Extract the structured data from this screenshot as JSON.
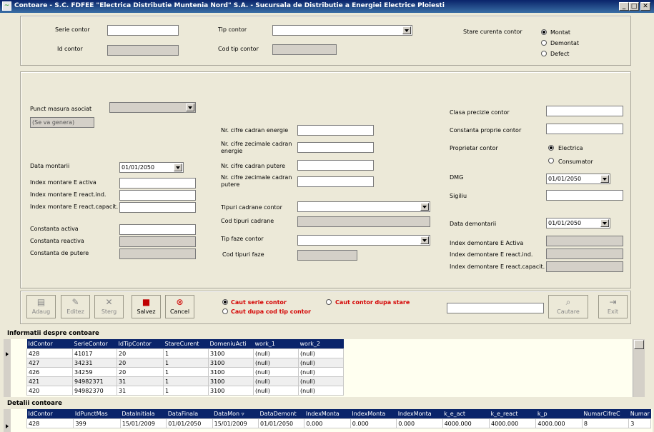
{
  "window": {
    "title": "Contoare - S.C. FDFEE \"Electrica Distributie Muntenia Nord\" S.A. - Sucursala de Distributie a Energiei Electrice Ploiesti",
    "minimize_glyph": "_",
    "maximize_glyph": "□",
    "close_glyph": "✕"
  },
  "top": {
    "serie_label": "Serie contor",
    "serie_value": "",
    "id_label": "Id contor",
    "tip_label": "Tip contor",
    "tip_value": "",
    "cod_tip_label": "Cod tip contor",
    "stare_label": "Stare curenta contor",
    "stare_options": [
      "Montat",
      "Demontat",
      "Defect"
    ],
    "stare_selected": "Montat"
  },
  "detail": {
    "punct_label": "Punct masura asociat",
    "punct_placeholder": "(Se va genera)",
    "data_montarii_label": "Data montarii",
    "data_montarii_value": "01/01/2050",
    "idx_activa_label": "Index montare E activa",
    "idx_react_ind_label": "Index montare E react.ind.",
    "idx_react_cap_label": "Index montare E react.capacit.",
    "const_activa_label": "Constanta activa",
    "const_reactiva_label": "Constanta reactiva",
    "const_putere_label": "Constanta de putere",
    "nr_cifre_energie_label": "Nr. cifre cadran energie",
    "nr_zec_energie_label": "Nr. cifre zecimale cadran energie",
    "nr_cifre_putere_label": "Nr. cifre cadran putere",
    "nr_zec_putere_label": "Nr. cifre zecimale cadran putere",
    "tipuri_cadrane_label": "Tipuri cadrane contor",
    "cod_tipuri_cadrane_label": "Cod tipuri cadrane",
    "tip_faze_label": "Tip faze contor",
    "cod_tipuri_faze_label": "Cod tipuri faze",
    "clasa_label": "Clasa precizie contor",
    "constanta_proprie_label": "Constanta proprie contor",
    "proprietar_label": "Proprietar contor",
    "proprietar_options": [
      "Electrica",
      "Consumator"
    ],
    "proprietar_selected": "Electrica",
    "dmg_label": "DMG",
    "dmg_value": "01/01/2050",
    "sigiliu_label": "Sigiliu",
    "data_demontarii_label": "Data demontarii",
    "data_demontarii_value": "01/01/2050",
    "idx_dem_activa_label": "Index demontare E Activa",
    "idx_dem_react_ind_label": "Index demontare E react.ind.",
    "idx_dem_react_cap_label": "Index demontare E react.capacit."
  },
  "toolbar": {
    "adaug": "Adaug",
    "editez": "Editez",
    "sterg": "Sterg",
    "salvez": "Salvez",
    "cancel": "Cancel",
    "search_opt_serie": "Caut serie contor",
    "search_opt_cod": "Caut dupa cod tip contor",
    "search_opt_stare": "Caut contor dupa stare",
    "search_value": "",
    "cautare": "Cautare",
    "exit": "Exit"
  },
  "grid1": {
    "title": "Informatii despre contoare",
    "columns": [
      "IdContor",
      "SerieContor",
      "IdTipContor",
      "StareCurent",
      "DomeniuActi",
      "work_1",
      "work_2"
    ],
    "rows": [
      [
        "428",
        "41017",
        "20",
        "1",
        "3100",
        "(null)",
        "(null)"
      ],
      [
        "427",
        "34231",
        "20",
        "1",
        "3100",
        "(null)",
        "(null)"
      ],
      [
        "426",
        "34259",
        "20",
        "1",
        "3100",
        "(null)",
        "(null)"
      ],
      [
        "421",
        "94982371",
        "31",
        "1",
        "3100",
        "(null)",
        "(null)"
      ],
      [
        "420",
        "94982370",
        "31",
        "1",
        "3100",
        "(null)",
        "(null)"
      ]
    ]
  },
  "grid2": {
    "title": "Detalii contoare",
    "columns": [
      "IdContor",
      "IdPunctMas",
      "DataInitiala",
      "DataFinala",
      "DataMon ▿",
      "DataDemont",
      "IndexMonta",
      "IndexMonta",
      "IndexMonta",
      "k_e_act",
      "k_e_react",
      "k_p",
      "NumarCifreC",
      "Numar"
    ],
    "rows": [
      [
        "428",
        "399",
        "15/01/2009",
        "01/01/2050",
        "15/01/2009",
        "01/01/2050",
        "0.000",
        "0.000",
        "0.000",
        "4000.000",
        "4000.000",
        "4000.000",
        "8",
        "3"
      ]
    ]
  }
}
